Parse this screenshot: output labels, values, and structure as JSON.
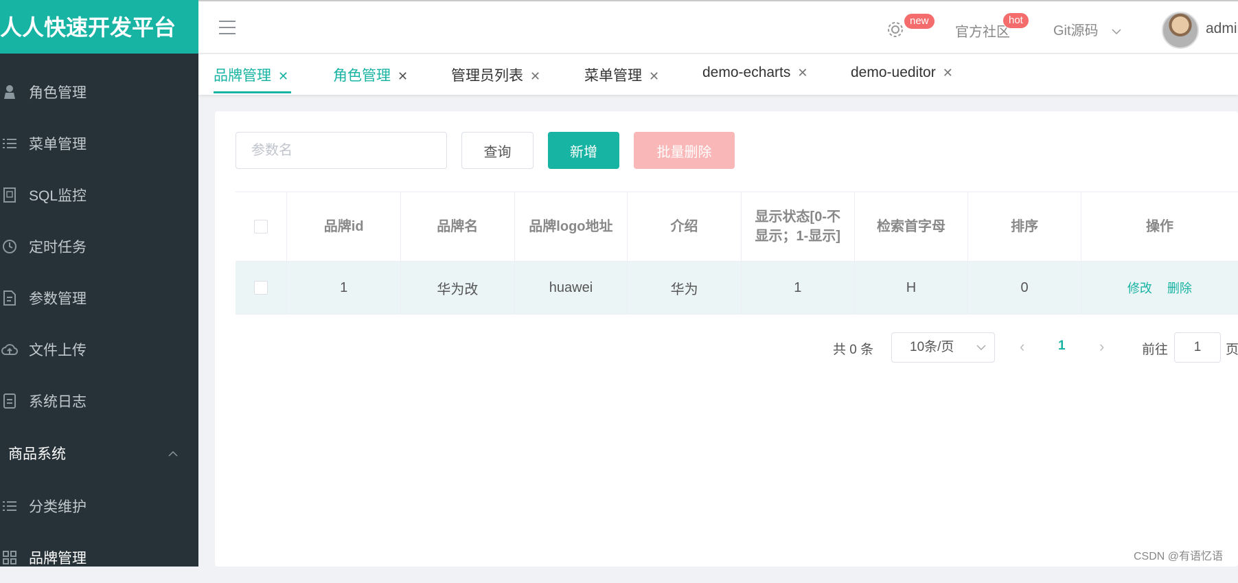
{
  "brand": "人人快速开发平台",
  "sidebar": {
    "items": [
      {
        "label": "角色管理",
        "icon": "user-role-icon"
      },
      {
        "label": "菜单管理",
        "icon": "list-icon"
      },
      {
        "label": "SQL监控",
        "icon": "sql-icon"
      },
      {
        "label": "定时任务",
        "icon": "clock-icon"
      },
      {
        "label": "参数管理",
        "icon": "document-icon"
      },
      {
        "label": "文件上传",
        "icon": "cloud-upload-icon"
      },
      {
        "label": "系统日志",
        "icon": "log-icon"
      }
    ],
    "group": {
      "label": "商品系统",
      "expanded": true
    },
    "subitems": [
      {
        "label": "分类维护",
        "icon": "list-icon"
      },
      {
        "label": "品牌管理",
        "icon": "grid-icon"
      }
    ]
  },
  "header": {
    "settings_badge": "new",
    "community": "官方社区",
    "community_badge": "hot",
    "git": "Git源码",
    "user": "admin"
  },
  "tabs": [
    {
      "label": "品牌管理",
      "active": true
    },
    {
      "label": "角色管理"
    },
    {
      "label": "管理员列表"
    },
    {
      "label": "菜单管理"
    },
    {
      "label": "demo-echarts"
    },
    {
      "label": "demo-ueditor"
    }
  ],
  "toolbar": {
    "search_placeholder": "参数名",
    "query": "查询",
    "add": "新增",
    "batch_delete": "批量删除"
  },
  "table": {
    "columns": [
      "品牌id",
      "品牌名",
      "品牌logo地址",
      "介绍",
      "显示状态[0-不显示；1-显示]",
      "检索首字母",
      "排序",
      "操作"
    ],
    "rows": [
      {
        "id": "1",
        "name": "华为改",
        "logo": "huawei",
        "intro": "华为",
        "status": "1",
        "letter": "H",
        "sort": "0",
        "edit": "修改",
        "delete": "删除"
      }
    ]
  },
  "pagination": {
    "total": "共 0 条",
    "page_size": "10条/页",
    "current": "1",
    "goto": "前往",
    "goto_value": "1",
    "page_suffix": "页"
  },
  "watermark": "CSDN @有语忆语",
  "colors": {
    "accent": "#17b3a3",
    "sidebar": "#263238",
    "danger_light": "#f9b7b7",
    "badge": "#f56c6c"
  }
}
